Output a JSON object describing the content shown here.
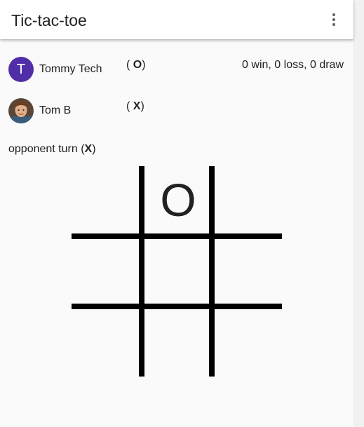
{
  "app": {
    "title": "Tic-tac-toe",
    "menu_icon": "more-vert-icon"
  },
  "players": [
    {
      "initial": "T",
      "name": "Tommy Tech",
      "symbol": "O",
      "record": "0 win, 0 loss, 0 draw",
      "avatar_color": "#512da8"
    },
    {
      "name": "Tom B",
      "symbol": "X",
      "avatar_icon": "user-photo-avatar"
    }
  ],
  "turn": {
    "text": "opponent turn",
    "symbol": "X"
  },
  "board": {
    "cells": [
      "",
      "O",
      "",
      "",
      "",
      "",
      "",
      "",
      ""
    ]
  }
}
